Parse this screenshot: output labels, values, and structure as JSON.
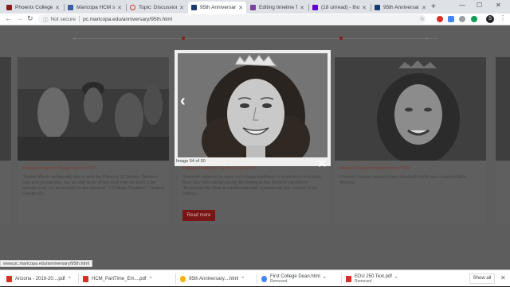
{
  "tabs": [
    {
      "label": "Phoenix College",
      "favicon_color": "#8a1c1c"
    },
    {
      "label": "Maricopa HCM se",
      "favicon_color": "#3a5fa0"
    },
    {
      "label": "Topic: Discussion",
      "favicon_color": "#d93025"
    },
    {
      "label": "95th Anniversary",
      "favicon_color": "#1a3b6e"
    },
    {
      "label": "Editing timeline Tc",
      "favicon_color": "#7b3fa0"
    },
    {
      "label": "(18 unread) - thom",
      "favicon_color": "#6001d2"
    },
    {
      "label": "95th Anniversary",
      "favicon_color": "#1a3b6e"
    }
  ],
  "address": {
    "security_label": "Not secure",
    "url": "pc.maricopa.edu/anniversary/95th.html"
  },
  "profile_initial": "S",
  "cards": [
    {
      "caption": "College Traditions Rodeo Week 1972",
      "body": "\"Rodeo Week traditionally ties in with the Phoenix JC Rodeo. Western togs are permissible, but no side arms of any kind may be worn. Live animals may not be brought to the campus\". (\"College Tradition\", Student Handbook)"
    },
    {
      "caption": "College Traditions Student Spirit 1973",
      "body": "Students continue to carry out college traditions of celebration including Bear Day and Homecoming. According to the Student Handbook, \"Bumstead the Bear is traditionally and symbolically the mascot of the college..."
    },
    {
      "caption": "Student Crowned Miss Arizona 1974",
      "body": "Phoenix College student Mary Elizabeth Avilla was crowned Miss Arizona."
    }
  ],
  "read_more_label": "Read more",
  "lightbox": {
    "counter": "Image 54 of 90",
    "prev_icon": "chevron-left-icon",
    "close_icon": "close-icon"
  },
  "status_url": "www.pc.maricopa.edu/anniversary/95th.html",
  "downloads": [
    {
      "name": "Arizona - 2019-20....pdf",
      "sub": "",
      "icon_color": "#d93025"
    },
    {
      "name": "HCM_PartTime_Em....pdf",
      "sub": "",
      "icon_color": "#d93025"
    },
    {
      "name": "95th Anniversary....html",
      "sub": "",
      "icon_color": "#f4b400"
    },
    {
      "name": "First College Dean.html",
      "sub": "Removed",
      "icon_color": "#4285f4"
    },
    {
      "name": "EDU 250 Text.pdf",
      "sub": "Removed",
      "icon_color": "#d93025"
    }
  ],
  "show_all_label": "Show all"
}
